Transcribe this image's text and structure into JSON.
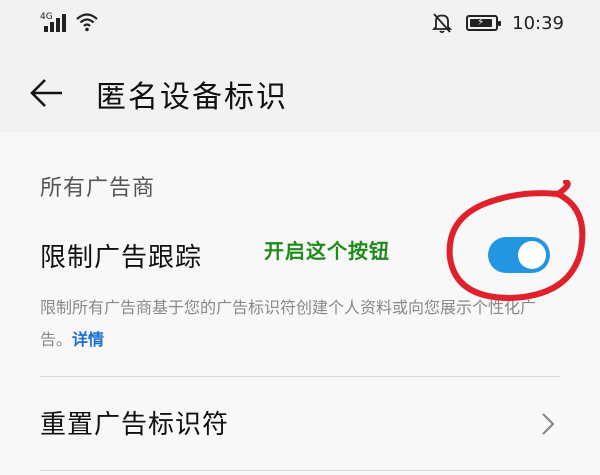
{
  "status_bar": {
    "network_type": "4G",
    "time": "10:39",
    "icons": [
      "signal-icon",
      "wifi-icon",
      "bell-muted-icon",
      "battery-charging-icon"
    ]
  },
  "header": {
    "title": "匿名设备标识",
    "back_icon": "back-arrow-icon"
  },
  "section": {
    "title": "所有广告商"
  },
  "limit_tracking": {
    "label": "限制广告跟踪",
    "toggle_on": true,
    "annotation": "开启这个按钮",
    "description": "限制所有广告商基于您的广告标识符创建个人资料或向您展示个性化广告。",
    "details_link": "详情"
  },
  "reset": {
    "label": "重置广告标识符",
    "chevron_icon": "chevron-right-icon"
  },
  "colors": {
    "accent": "#2495e0",
    "link": "#1a6fd0",
    "annotation": "#1f8a1a",
    "highlight": "#e0202a"
  }
}
